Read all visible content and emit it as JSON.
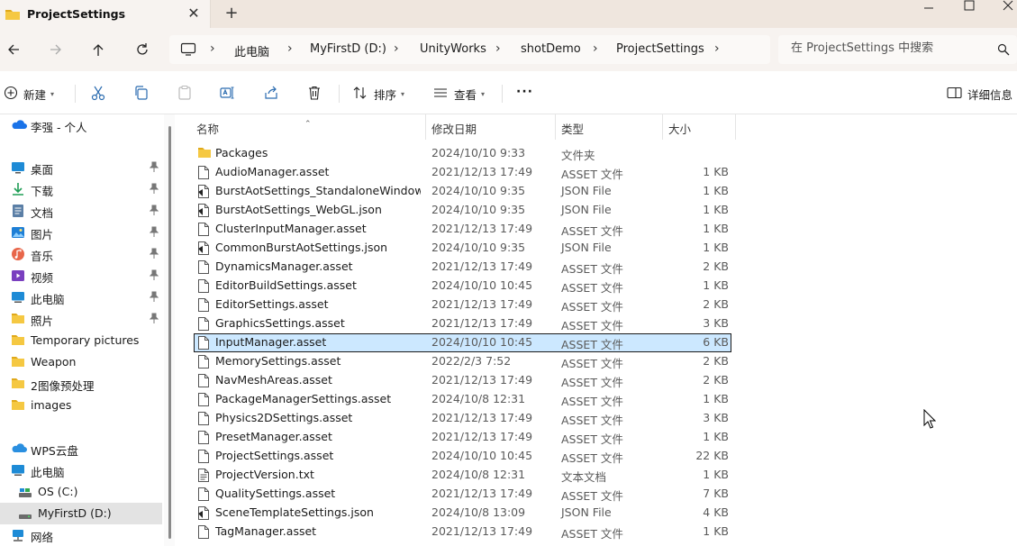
{
  "window": {
    "tab_title": "ProjectSettings",
    "close_tab_glyph": "✕",
    "new_tab_glyph": "+",
    "tab_icon": "folder-icon"
  },
  "address": {
    "root_icon": "pc-icon",
    "breadcrumbs": [
      "此电脑",
      "MyFirstD (D:)",
      "UnityWorks",
      "shotDemo",
      "ProjectSettings"
    ],
    "separator": "›"
  },
  "search": {
    "placeholder": "在 ProjectSettings 中搜索"
  },
  "commands": {
    "new_label": "新建",
    "sort_label": "排序",
    "view_label": "查看",
    "more_label": "···",
    "details_label": "详细信息"
  },
  "sidebar": {
    "items": [
      {
        "label": "李强 - 个人",
        "icon": "onedrive-cloud-icon",
        "pinned": false
      },
      {
        "label": "桌面",
        "icon": "desktop-icon",
        "pinned": true
      },
      {
        "label": "下载",
        "icon": "download-icon",
        "pinned": true
      },
      {
        "label": "文档",
        "icon": "document-icon",
        "pinned": true
      },
      {
        "label": "图片",
        "icon": "pictures-icon",
        "pinned": true
      },
      {
        "label": "音乐",
        "icon": "music-icon",
        "pinned": true
      },
      {
        "label": "视频",
        "icon": "videos-icon",
        "pinned": true
      },
      {
        "label": "此电脑",
        "icon": "pc-icon",
        "pinned": true
      },
      {
        "label": "照片",
        "icon": "folder-icon",
        "pinned": true
      },
      {
        "label": "Temporary pictures",
        "icon": "folder-icon",
        "pinned": false
      },
      {
        "label": "Weapon",
        "icon": "folder-icon",
        "pinned": false
      },
      {
        "label": "2图像预处理",
        "icon": "folder-icon",
        "pinned": false
      },
      {
        "label": "images",
        "icon": "folder-icon",
        "pinned": false
      },
      {
        "label": "WPS云盘",
        "icon": "wps-cloud-icon",
        "pinned": false
      },
      {
        "label": "此电脑",
        "icon": "pc-icon",
        "pinned": false
      },
      {
        "label": "OS (C:)",
        "icon": "drive-icon",
        "pinned": false
      },
      {
        "label": "MyFirstD (D:)",
        "icon": "drive-icon",
        "pinned": false,
        "selected": true
      },
      {
        "label": "网络",
        "icon": "network-icon",
        "pinned": false
      }
    ]
  },
  "columns": {
    "name": "名称",
    "date": "修改日期",
    "type": "类型",
    "size": "大小"
  },
  "files": [
    {
      "name": "Packages",
      "date": "2024/10/10 9:33",
      "type": "文件夹",
      "size": "",
      "icon": "folder-icon"
    },
    {
      "name": "AudioManager.asset",
      "date": "2021/12/13 17:49",
      "type": "ASSET 文件",
      "size": "1 KB",
      "icon": "file-icon"
    },
    {
      "name": "BurstAotSettings_StandaloneWindow...",
      "date": "2024/10/10 9:35",
      "type": "JSON File",
      "size": "1 KB",
      "icon": "json-file-icon"
    },
    {
      "name": "BurstAotSettings_WebGL.json",
      "date": "2024/10/10 9:35",
      "type": "JSON File",
      "size": "1 KB",
      "icon": "json-file-icon"
    },
    {
      "name": "ClusterInputManager.asset",
      "date": "2021/12/13 17:49",
      "type": "ASSET 文件",
      "size": "1 KB",
      "icon": "file-icon"
    },
    {
      "name": "CommonBurstAotSettings.json",
      "date": "2024/10/10 9:35",
      "type": "JSON File",
      "size": "1 KB",
      "icon": "json-file-icon"
    },
    {
      "name": "DynamicsManager.asset",
      "date": "2021/12/13 17:49",
      "type": "ASSET 文件",
      "size": "2 KB",
      "icon": "file-icon"
    },
    {
      "name": "EditorBuildSettings.asset",
      "date": "2024/10/10 10:45",
      "type": "ASSET 文件",
      "size": "1 KB",
      "icon": "file-icon"
    },
    {
      "name": "EditorSettings.asset",
      "date": "2021/12/13 17:49",
      "type": "ASSET 文件",
      "size": "2 KB",
      "icon": "file-icon"
    },
    {
      "name": "GraphicsSettings.asset",
      "date": "2021/12/13 17:49",
      "type": "ASSET 文件",
      "size": "3 KB",
      "icon": "file-icon"
    },
    {
      "name": "InputManager.asset",
      "date": "2024/10/10 10:45",
      "type": "ASSET 文件",
      "size": "6 KB",
      "icon": "file-icon",
      "selected": true
    },
    {
      "name": "MemorySettings.asset",
      "date": "2022/2/3 7:52",
      "type": "ASSET 文件",
      "size": "2 KB",
      "icon": "file-icon"
    },
    {
      "name": "NavMeshAreas.asset",
      "date": "2021/12/13 17:49",
      "type": "ASSET 文件",
      "size": "2 KB",
      "icon": "file-icon"
    },
    {
      "name": "PackageManagerSettings.asset",
      "date": "2024/10/8 12:31",
      "type": "ASSET 文件",
      "size": "1 KB",
      "icon": "file-icon"
    },
    {
      "name": "Physics2DSettings.asset",
      "date": "2021/12/13 17:49",
      "type": "ASSET 文件",
      "size": "3 KB",
      "icon": "file-icon"
    },
    {
      "name": "PresetManager.asset",
      "date": "2021/12/13 17:49",
      "type": "ASSET 文件",
      "size": "1 KB",
      "icon": "file-icon"
    },
    {
      "name": "ProjectSettings.asset",
      "date": "2024/10/10 10:45",
      "type": "ASSET 文件",
      "size": "22 KB",
      "icon": "file-icon"
    },
    {
      "name": "ProjectVersion.txt",
      "date": "2024/10/8 12:31",
      "type": "文本文档",
      "size": "1 KB",
      "icon": "text-file-icon"
    },
    {
      "name": "QualitySettings.asset",
      "date": "2021/12/13 17:49",
      "type": "ASSET 文件",
      "size": "7 KB",
      "icon": "file-icon"
    },
    {
      "name": "SceneTemplateSettings.json",
      "date": "2024/10/8 13:09",
      "type": "JSON File",
      "size": "4 KB",
      "icon": "json-file-icon"
    },
    {
      "name": "TagManager.asset",
      "date": "2021/12/13 17:49",
      "type": "ASSET 文件",
      "size": "1 KB",
      "icon": "file-icon"
    }
  ],
  "colors": {
    "titlebar_bg": "#efe6de",
    "selection_bg": "#cce8ff",
    "folder_yellow": "#f5c842",
    "onedrive_blue": "#1a73e8"
  }
}
